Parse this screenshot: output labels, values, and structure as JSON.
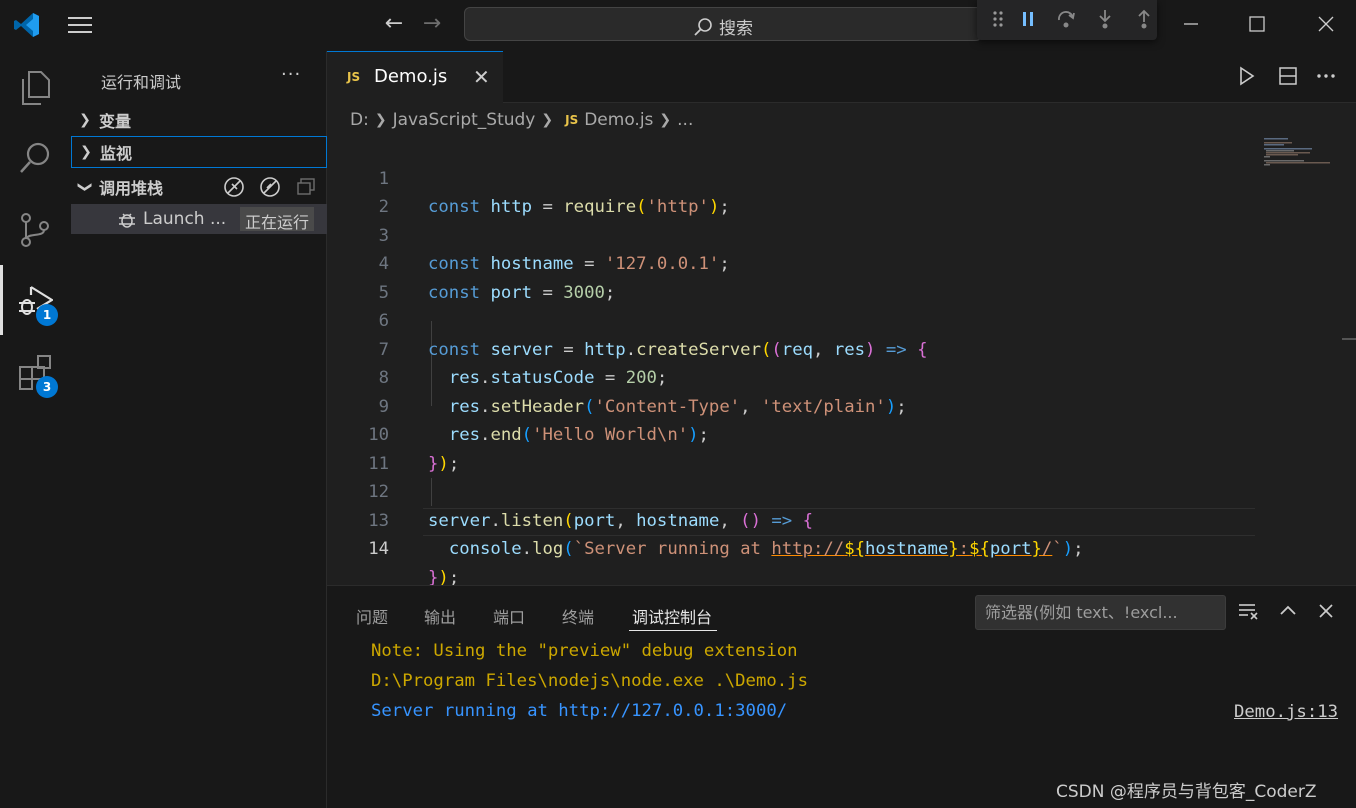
{
  "titlebar": {
    "search_label": "搜索"
  },
  "activity": {
    "run_badge": "1",
    "extensions_badge": "3"
  },
  "sidebar": {
    "title": "运行和调试",
    "more": "···",
    "sections": {
      "variables": "变量",
      "watch": "监视",
      "callstack": "调用堆栈"
    },
    "session": {
      "label": "Launch ...",
      "status": "正在运行"
    }
  },
  "editor": {
    "tab": {
      "badge": "JS",
      "label": "Demo.js"
    },
    "breadcrumb": {
      "drive": "D:",
      "folder": "JavaScript_Study",
      "badge": "JS",
      "file": "Demo.js",
      "more": "..."
    },
    "line_numbers": [
      "1",
      "2",
      "3",
      "4",
      "5",
      "6",
      "7",
      "8",
      "9",
      "10",
      "11",
      "12",
      "13",
      "14"
    ],
    "code": {
      "l1": [
        "const",
        " ",
        "http",
        " = ",
        "require",
        "(",
        "'http'",
        ")",
        ";"
      ],
      "l3": [
        "const",
        " ",
        "hostname",
        " = ",
        "'127.0.0.1'",
        ";"
      ],
      "l4": [
        "const",
        " ",
        "port",
        " = ",
        "3000",
        ";"
      ],
      "l6": [
        "const",
        " ",
        "server",
        " = ",
        "http",
        ".",
        "createServer",
        "(",
        "(",
        "req",
        ", ",
        "res",
        ")",
        " ",
        "=>",
        " ",
        "{"
      ],
      "l7": [
        "  ",
        "res",
        ".",
        "statusCode",
        " = ",
        "200",
        ";"
      ],
      "l8": [
        "  ",
        "res",
        ".",
        "setHeader",
        "(",
        "'Content-Type'",
        ", ",
        "'text/plain'",
        ")",
        ";"
      ],
      "l9": [
        "  ",
        "res",
        ".",
        "end",
        "(",
        "'Hello World\\n'",
        ")",
        ";"
      ],
      "l10": [
        "}",
        ")",
        ";"
      ],
      "l12": [
        "server",
        ".",
        "listen",
        "(",
        "port",
        ", ",
        "hostname",
        ", ",
        "(",
        ")",
        " ",
        "=>",
        " ",
        "{"
      ],
      "l13": [
        "  ",
        "console",
        ".",
        "log",
        "(",
        "`Server running at ",
        "http://",
        "${",
        "hostname",
        "}",
        ":",
        "${",
        "port",
        "}",
        "/",
        "`",
        ")",
        ";"
      ],
      "l14": [
        "}",
        ")",
        ";"
      ]
    }
  },
  "panel": {
    "tabs": [
      "问题",
      "输出",
      "端口",
      "终端",
      "调试控制台"
    ],
    "filter_placeholder": "筛选器(例如 text、!excl...",
    "console": [
      "Note: Using the \"preview\" debug extension",
      "D:\\Program Files\\nodejs\\node.exe .\\Demo.js",
      "Server running at http://127.0.0.1:3000/"
    ],
    "console_source": "Demo.js:13"
  },
  "watermark": "CSDN @程序员与背包客_CoderZ",
  "colors": {
    "accent": "#0078d4",
    "keyword": "#569cd6",
    "string": "#ce9178",
    "number": "#b5cea8",
    "function": "#dcdcaa",
    "variable": "#9cdcfe",
    "console_warn": "#cca700",
    "console_info": "#3794ff"
  }
}
